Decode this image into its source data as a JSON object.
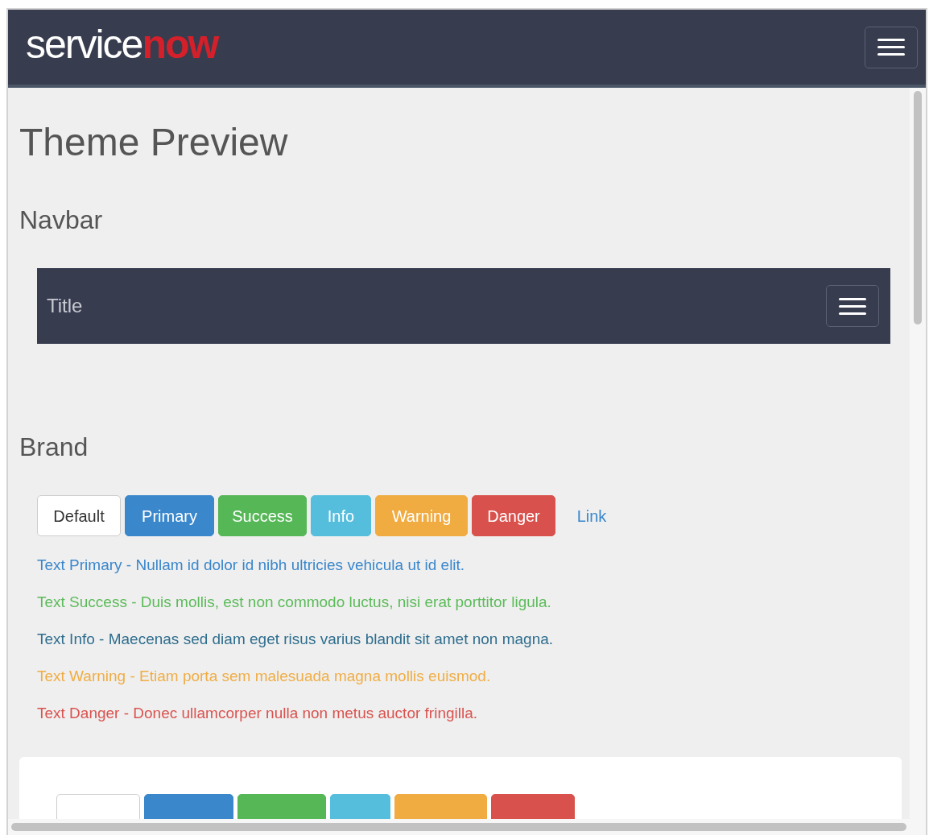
{
  "header": {
    "logo": {
      "part_1": "service",
      "part_2": "now"
    }
  },
  "page_title": "Theme Preview",
  "sections": [
    {
      "heading": "Navbar",
      "navbar": {
        "title": "Title"
      }
    },
    {
      "heading": "Brand"
    }
  ],
  "buttons": [
    {
      "label": "Default",
      "kind": "default"
    },
    {
      "label": "Primary",
      "kind": "primary"
    },
    {
      "label": "Success",
      "kind": "success"
    },
    {
      "label": "Info",
      "kind": "info"
    },
    {
      "label": "Warning",
      "kind": "warning"
    },
    {
      "label": "Danger",
      "kind": "danger"
    },
    {
      "label": "Link",
      "kind": "link"
    }
  ],
  "text_samples": [
    {
      "text": "Text Primary - Nullam id dolor id nibh ultricies vehicula ut id elit.",
      "color": "#3a87cc"
    },
    {
      "text": "Text Success - Duis mollis, est non commodo luctus, nisi erat porttitor ligula.",
      "color": "#5cbb5a"
    },
    {
      "text": "Text Info - Maecenas sed diam eget risus varius blandit sit amet non magna.",
      "color": "#2f6e8e"
    },
    {
      "text": "Text Warning - Etiam porta sem malesuada magna mollis euismod.",
      "color": "#f0ad44"
    },
    {
      "text": "Text Danger - Donec ullamcorper nulla non metus auctor fringilla.",
      "color": "#d9534f"
    }
  ],
  "card_buttons": [
    {
      "kind": "default"
    },
    {
      "kind": "primary"
    },
    {
      "kind": "success"
    },
    {
      "kind": "info"
    },
    {
      "kind": "warning"
    },
    {
      "kind": "danger"
    }
  ]
}
